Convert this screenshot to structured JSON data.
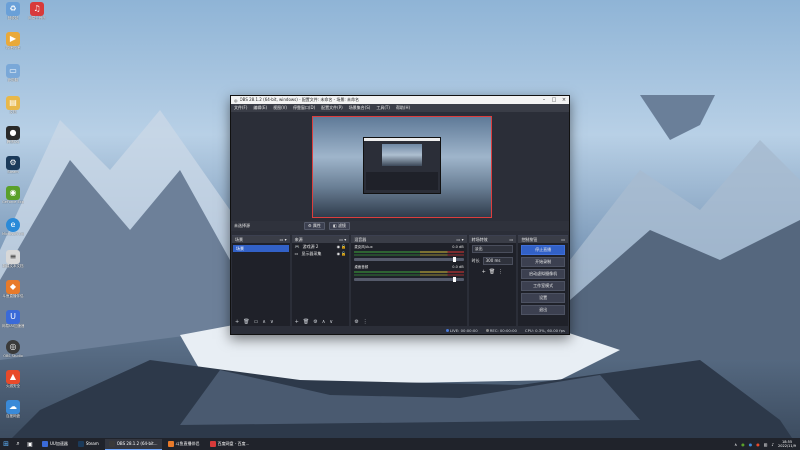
{
  "desktop": {
    "icons": [
      {
        "label": "回收站",
        "icon": "recycle-bin-icon",
        "color": "#6aa0d8"
      },
      {
        "label": "网易云音乐",
        "icon": "netease-music-icon",
        "color": "#d83a3a"
      },
      {
        "label": "哔哩哔哩",
        "icon": "bilibili-icon",
        "color": "#e9a93a"
      },
      {
        "label": "此电脑",
        "icon": "computer-icon",
        "color": "#7aa8d8"
      },
      {
        "label": "文档",
        "icon": "document-icon",
        "color": "#e8b84a"
      },
      {
        "label": "腾讯QQ",
        "icon": "qq-icon",
        "color": "#2a2a2a"
      },
      {
        "label": "Steam",
        "icon": "steam-icon",
        "color": "#1b3a5a"
      },
      {
        "label": "GeForce Experience",
        "icon": "nvidia-icon",
        "color": "#5aa02a"
      },
      {
        "label": "Microsoft Edge",
        "icon": "edge-icon",
        "color": "#2a8ad8"
      },
      {
        "label": "新建文本文档",
        "icon": "text-file-icon",
        "color": "#d8d8d8"
      },
      {
        "label": "斗鱼直播伴侣",
        "icon": "douyu-icon",
        "color": "#e87a2a"
      },
      {
        "label": "网易UU加速器",
        "icon": "uu-icon",
        "color": "#3a6ad8"
      },
      {
        "label": "OBS Studio",
        "icon": "obs-icon",
        "color": "#3a3a3a"
      },
      {
        "label": "火绒安全",
        "icon": "huorong-icon",
        "color": "#e84a2a"
      },
      {
        "label": "百度网盘",
        "icon": "baidu-netdisk-icon",
        "color": "#3a8ad8"
      }
    ]
  },
  "obs": {
    "title": "OBS 28.1.2 (64-bit, windows) - 配置文件: 未命名 - 场景: 未命名",
    "menu": [
      "文件(F)",
      "编辑(E)",
      "视图(V)",
      "停靠窗口(D)",
      "配置文件(P)",
      "场景集合(S)",
      "工具(T)",
      "帮助(H)"
    ],
    "scene_bar": {
      "title": "未选择源",
      "props": "属性",
      "filters": "滤镜"
    },
    "docks": {
      "scenes": {
        "title": "场景",
        "items": [
          "场景"
        ]
      },
      "sources": {
        "title": "来源",
        "items": [
          {
            "name": "游戏源 2",
            "icon": "game-capture-icon"
          },
          {
            "name": "显示器采集",
            "icon": "monitor-icon"
          }
        ]
      },
      "mixer": {
        "title": "混音器",
        "channels": [
          {
            "name": "麦克风/Aux",
            "db": "0.0 dB"
          },
          {
            "name": "桌面音频",
            "db": "0.0 dB"
          }
        ]
      },
      "transitions": {
        "title": "转场特效",
        "type": "淡出",
        "duration_label": "时长",
        "duration": "300 ms"
      },
      "controls": {
        "title": "控制按钮",
        "buttons": [
          "停止直播",
          "开始录制",
          "启动虚拟摄像机",
          "工作室模式",
          "设置",
          "退出"
        ]
      }
    },
    "status": {
      "live": "LIVE: 00:00:00",
      "rec": "REC: 00:00:00",
      "cpu": "CPU: 0.3%, 60.00 fps"
    }
  },
  "taskbar": {
    "tasks": [
      {
        "label": "UU加速器",
        "color": "#3a6ad8"
      },
      {
        "label": "Steam",
        "color": "#1b3a5a"
      },
      {
        "label": "OBS 28.1.2 (64-bit...",
        "color": "#3a3a3a",
        "active": true
      },
      {
        "label": "斗鱼直播伴侣",
        "color": "#e87a2a"
      },
      {
        "label": "百度网盘 - 百度...",
        "color": "#d83a3a"
      }
    ],
    "time": "18:55",
    "date": "2022/11/9"
  }
}
